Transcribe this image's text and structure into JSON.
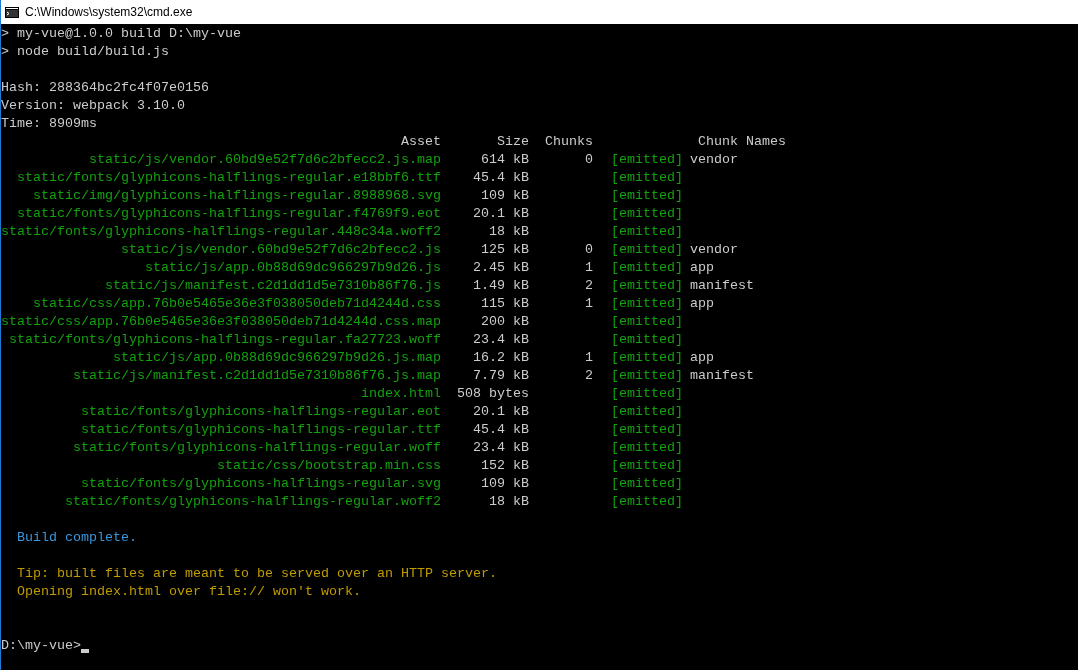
{
  "window": {
    "title": "C:\\Windows\\system32\\cmd.exe"
  },
  "command_lines": [
    "> my-vue@1.0.0 build D:\\my-vue",
    "> node build/build.js"
  ],
  "stats": [
    "Hash: 288364bc2fc4f07e0156",
    "Version: webpack 3.10.0",
    "Time: 8909ms"
  ],
  "table": {
    "columns": [
      "Asset",
      "Size",
      "Chunks",
      "Chunk Names"
    ],
    "rows": [
      {
        "asset": "static/js/vendor.60bd9e52f7d6c2bfecc2.js.map",
        "size": "614 kB",
        "chunks": "0",
        "status": "[emitted]",
        "chunk_names": "vendor"
      },
      {
        "asset": "static/fonts/glyphicons-halflings-regular.e18bbf6.ttf",
        "size": "45.4 kB",
        "status": "[emitted]"
      },
      {
        "asset": "static/img/glyphicons-halflings-regular.8988968.svg",
        "size": "109 kB",
        "status": "[emitted]"
      },
      {
        "asset": "static/fonts/glyphicons-halflings-regular.f4769f9.eot",
        "size": "20.1 kB",
        "status": "[emitted]"
      },
      {
        "asset": "static/fonts/glyphicons-halflings-regular.448c34a.woff2",
        "size": "18 kB",
        "status": "[emitted]"
      },
      {
        "asset": "static/js/vendor.60bd9e52f7d6c2bfecc2.js",
        "size": "125 kB",
        "chunks": "0",
        "status": "[emitted]",
        "chunk_names": "vendor"
      },
      {
        "asset": "static/js/app.0b88d69dc966297b9d26.js",
        "size": "2.45 kB",
        "chunks": "1",
        "status": "[emitted]",
        "chunk_names": "app"
      },
      {
        "asset": "static/js/manifest.c2d1dd1d5e7310b86f76.js",
        "size": "1.49 kB",
        "chunks": "2",
        "status": "[emitted]",
        "chunk_names": "manifest"
      },
      {
        "asset": "static/css/app.76b0e5465e36e3f038050deb71d4244d.css",
        "size": "115 kB",
        "chunks": "1",
        "status": "[emitted]",
        "chunk_names": "app"
      },
      {
        "asset": "static/css/app.76b0e5465e36e3f038050deb71d4244d.css.map",
        "size": "200 kB",
        "status": "[emitted]"
      },
      {
        "asset": "static/fonts/glyphicons-halflings-regular.fa27723.woff",
        "size": "23.4 kB",
        "status": "[emitted]"
      },
      {
        "asset": "static/js/app.0b88d69dc966297b9d26.js.map",
        "size": "16.2 kB",
        "chunks": "1",
        "status": "[emitted]",
        "chunk_names": "app"
      },
      {
        "asset": "static/js/manifest.c2d1dd1d5e7310b86f76.js.map",
        "size": "7.79 kB",
        "chunks": "2",
        "status": "[emitted]",
        "chunk_names": "manifest"
      },
      {
        "asset": "index.html",
        "size": "508 bytes",
        "status": "[emitted]"
      },
      {
        "asset": "static/fonts/glyphicons-halflings-regular.eot",
        "size": "20.1 kB",
        "status": "[emitted]"
      },
      {
        "asset": "static/fonts/glyphicons-halflings-regular.ttf",
        "size": "45.4 kB",
        "status": "[emitted]"
      },
      {
        "asset": "static/fonts/glyphicons-halflings-regular.woff",
        "size": "23.4 kB",
        "status": "[emitted]"
      },
      {
        "asset": "static/css/bootstrap.min.css",
        "size": "152 kB",
        "status": "[emitted]"
      },
      {
        "asset": "static/fonts/glyphicons-halflings-regular.svg",
        "size": "109 kB",
        "status": "[emitted]"
      },
      {
        "asset": "static/fonts/glyphicons-halflings-regular.woff2",
        "size": "18 kB",
        "status": "[emitted]"
      }
    ]
  },
  "messages": [
    {
      "kind": "success",
      "text": "Build complete."
    },
    {
      "kind": "tip",
      "text": "Tip: built files are meant to be served over an HTTP server."
    },
    {
      "kind": "tip",
      "text": "Opening index.html over file:// won't work."
    }
  ],
  "prompt": "D:\\my-vue>"
}
